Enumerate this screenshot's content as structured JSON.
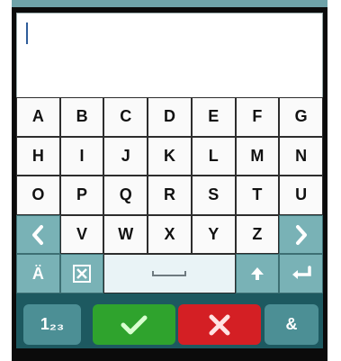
{
  "keyboard": {
    "rows": [
      [
        "A",
        "B",
        "C",
        "D",
        "E",
        "F",
        "G"
      ],
      [
        "H",
        "I",
        "J",
        "K",
        "L",
        "M",
        "N"
      ],
      [
        "O",
        "P",
        "Q",
        "R",
        "S",
        "T",
        "U"
      ],
      [
        "",
        "V",
        "W",
        "X",
        "Y",
        "Z",
        ""
      ],
      [
        "Ä",
        "",
        ""
      ]
    ],
    "row4_left_icon": "chevron-left-icon",
    "row4_right_icon": "chevron-right-icon",
    "row5_special": {
      "umlaut_label": "Ä",
      "delete_icon": "delete-icon",
      "space_icon": "space-icon",
      "shift_icon": "shift-up-icon",
      "enter_icon": "enter-icon"
    }
  },
  "bottom": {
    "numbers_label": "1₂₃",
    "ok_icon": "check-icon",
    "cancel_icon": "x-icon",
    "symbols_label": "&"
  },
  "colors": {
    "background": "#ffffff",
    "keyboard_bg": "#1d5960",
    "teal_key": "#79b2b6",
    "key_white": "#fafafa",
    "ok_green": "#2fa32d",
    "cancel_red": "#d41f24"
  },
  "input": {
    "value": ""
  }
}
